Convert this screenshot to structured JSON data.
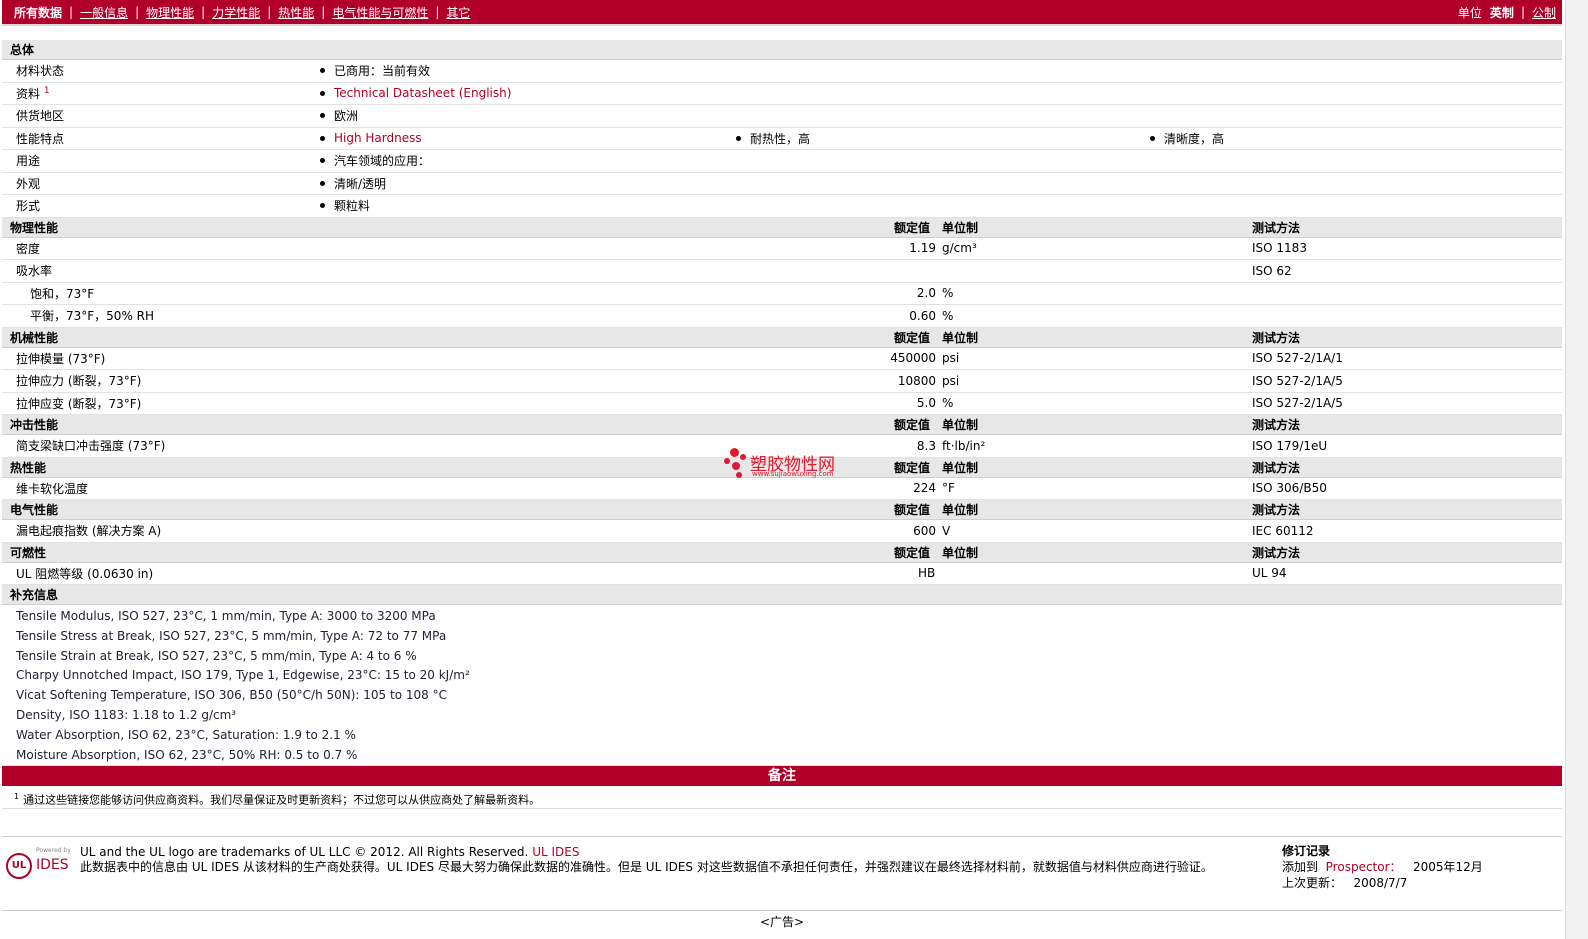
{
  "nav": {
    "items": [
      "所有数据",
      "一般信息",
      "物理性能",
      "力学性能",
      "热性能",
      "电气性能与可燃性",
      "其它"
    ],
    "units_label": "单位",
    "units_current": "英制",
    "units_other": "公制"
  },
  "general": {
    "title": "总体",
    "material_status_label": "材料状态",
    "material_status": "已商用：当前有效",
    "docs_label": "资料",
    "docs_sup": "1",
    "docs_link": "Technical Datasheet (English)",
    "region_label": "供货地区",
    "region": "欧洲",
    "features_label": "性能特点",
    "features": [
      "High Hardness",
      "耐热性，高",
      "清晰度，高"
    ],
    "uses_label": "用途",
    "uses": "汽车领域的应用：",
    "appearance_label": "外观",
    "appearance": "清晰/透明",
    "form_label": "形式",
    "form": "颗粒料"
  },
  "headers": {
    "rated": "额定值",
    "unit": "单位制",
    "method": "测试方法"
  },
  "physical": {
    "title": "物理性能",
    "rows": [
      {
        "label": "密度",
        "value": "1.19",
        "unit": "g/cm³",
        "method": "ISO 1183",
        "sub": false
      },
      {
        "label": "吸水率",
        "value": "",
        "unit": "",
        "method": "ISO 62",
        "sub": false
      },
      {
        "label": "饱和，73°F",
        "value": "2.0",
        "unit": "%",
        "method": "",
        "sub": true
      },
      {
        "label": "平衡，73°F，50% RH",
        "value": "0.60",
        "unit": "%",
        "method": "",
        "sub": true
      }
    ]
  },
  "mechanical": {
    "title": "机械性能",
    "rows": [
      {
        "label": "拉伸模量 (73°F)",
        "value": "450000",
        "unit": "psi",
        "method": "ISO 527-2/1A/1"
      },
      {
        "label": "拉伸应力 (断裂，73°F)",
        "value": "10800",
        "unit": "psi",
        "method": "ISO 527-2/1A/5"
      },
      {
        "label": "拉伸应变 (断裂，73°F)",
        "value": "5.0",
        "unit": "%",
        "method": "ISO 527-2/1A/5"
      }
    ]
  },
  "impact": {
    "title": "冲击性能",
    "rows": [
      {
        "label": "简支梁缺口冲击强度 (73°F)",
        "value": "8.3",
        "unit": "ft·lb/in²",
        "method": "ISO 179/1eU"
      }
    ]
  },
  "thermal": {
    "title": "热性能",
    "rows": [
      {
        "label": "维卡软化温度",
        "value": "224",
        "unit": "°F",
        "method": "ISO 306/B50"
      }
    ]
  },
  "electrical": {
    "title": "电气性能",
    "rows": [
      {
        "label": "漏电起痕指数 (解决方案 A)",
        "value": "600",
        "unit": "V",
        "method": "IEC 60112"
      }
    ]
  },
  "flammability": {
    "title": "可燃性",
    "rows": [
      {
        "label": "UL 阻燃等级 (0.0630 in)",
        "value": "HB",
        "unit": "",
        "method": "UL 94"
      }
    ]
  },
  "supplemental": {
    "title": "补充信息",
    "lines": [
      "Tensile Modulus, ISO 527, 23°C, 1 mm/min, Type A: 3000 to 3200 MPa",
      "Tensile Stress at Break, ISO 527, 23°C, 5 mm/min, Type A: 72 to 77 MPa",
      "Tensile Strain at Break, ISO 527, 23°C, 5 mm/min, Type A: 4 to 6 %",
      "Charpy Unnotched Impact, ISO 179, Type 1, Edgewise, 23°C: 15 to 20 kJ/m²",
      "Vicat Softening Temperature, ISO 306, B50 (50°C/h 50N): 105 to 108 °C",
      "Density, ISO 1183: 1.18 to 1.2 g/cm³",
      "Water Absorption, ISO 62, 23°C, Saturation: 1.9 to 2.1 %",
      "Moisture Absorption, ISO 62, 23°C, 50% RH: 0.5 to 0.7 %"
    ]
  },
  "notes": {
    "title": "备注",
    "footnote_num": "1",
    "footnote": "通过这些链接您能够访问供应商资料。我们尽量保证及时更新资料；不过您可以从供应商处了解最新资料。"
  },
  "footer": {
    "logo_powered": "Powered by",
    "logo_ul": "UL",
    "logo_ides": "IDES",
    "line1_a": "UL and the UL logo are trademarks of UL LLC © 2012. All Rights Reserved.",
    "line1_b": "UL IDES",
    "line2": "此数据表中的信息由 UL IDES 从该材料的生产商处获得。UL IDES 尽最大努力确保此数据的准确性。但是 UL IDES 对这些数据值不承担任何责任，并强烈建议在最终选择材料前，就数据值与材料供应商进行验证。",
    "rev_title": "修订记录",
    "added_label": "添加到",
    "added_target": "Prospector：",
    "added_date": "2005年12月",
    "updated_label": "上次更新：",
    "updated_date": "2008/7/7"
  },
  "ad": "<广告>",
  "watermark": {
    "text": "塑胶物性网",
    "url": "www.sujiaowuxing.com"
  }
}
